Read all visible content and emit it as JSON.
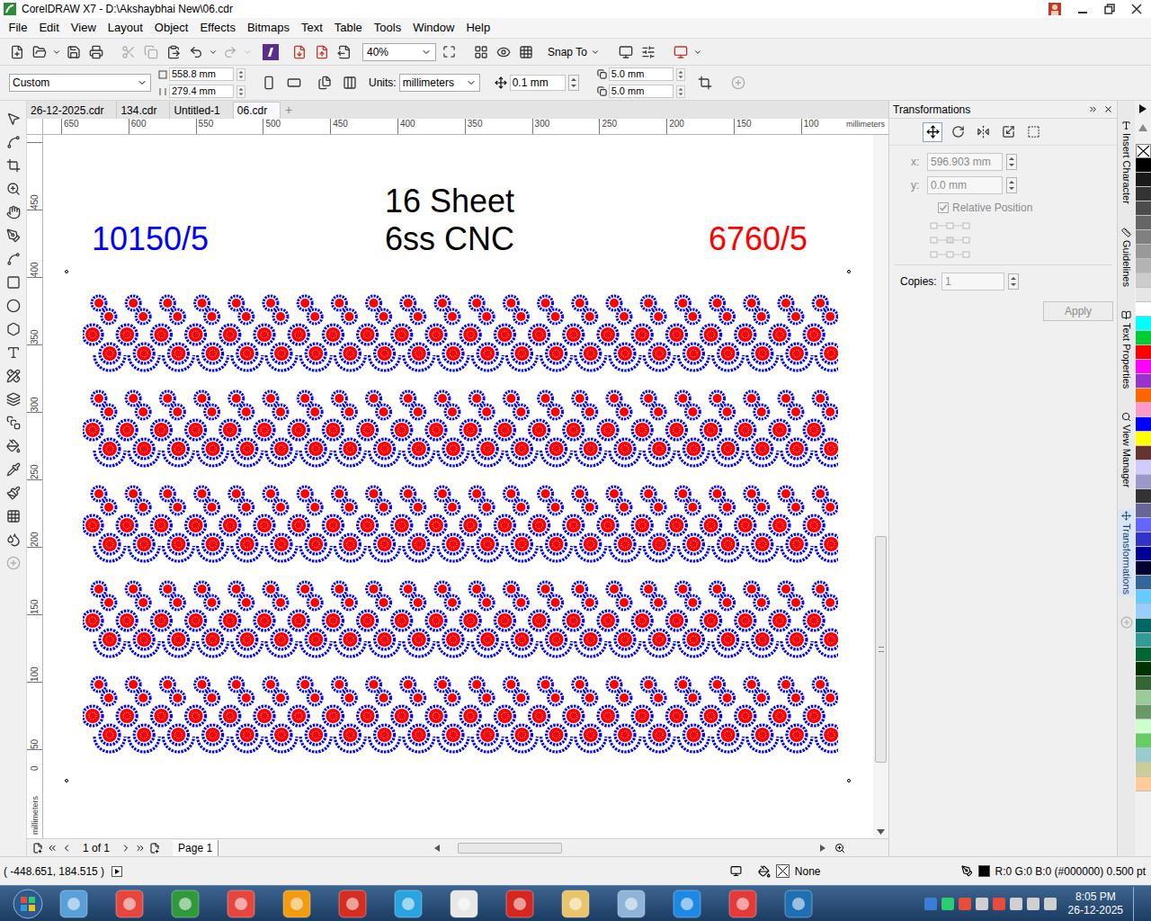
{
  "window": {
    "title": "CorelDRAW X7 - D:\\Akshaybhai New\\06.cdr"
  },
  "menu": [
    "File",
    "Edit",
    "View",
    "Layout",
    "Object",
    "Effects",
    "Bitmaps",
    "Text",
    "Table",
    "Tools",
    "Window",
    "Help"
  ],
  "toolbar": {
    "zoom": "40%",
    "snap": "Snap To"
  },
  "property_bar": {
    "preset": "Custom",
    "width": "558.8 mm",
    "height": "279.4 mm",
    "units_label": "Units:",
    "units": "millimeters",
    "nudge": "0.1 mm",
    "dup_x": "5.0 mm",
    "dup_y": "5.0 mm"
  },
  "doc_tabs": [
    {
      "label": "26-12-2025.cdr",
      "selected": false
    },
    {
      "label": "134.cdr",
      "selected": false
    },
    {
      "label": "Untitled-1",
      "selected": false
    },
    {
      "label": "06.cdr",
      "selected": true
    }
  ],
  "new_tab": "+",
  "rulers": {
    "horizontal": [
      "650",
      "600",
      "550",
      "500",
      "450",
      "400",
      "350",
      "300",
      "250",
      "200",
      "150",
      "100"
    ],
    "vertical": [
      "450",
      "400",
      "350",
      "300",
      "250",
      "200",
      "150",
      "100",
      "50",
      "0"
    ],
    "unit": "millimeters"
  },
  "document": {
    "title_lines": [
      "16 Sheet",
      "6ss CNC"
    ],
    "left_label": {
      "text": "10150/5",
      "color": "#0000ff"
    },
    "right_label": {
      "text": "6760/5",
      "color": "#ff0000"
    },
    "pattern": {
      "rows": 5,
      "columns": 22,
      "ring_color": "#0000ff",
      "center_color": "#ff0000"
    }
  },
  "page_nav": {
    "counter": "1 of 1",
    "pages": [
      {
        "label": "Page 1",
        "selected": true
      }
    ]
  },
  "docker": {
    "title": "Transformations",
    "x_label": "x:",
    "x": "596.903 mm",
    "y_label": "y:",
    "y": "0.0 mm",
    "relative": {
      "label": "Relative Position",
      "checked": true,
      "disabled": true
    },
    "copies_label": "Copies:",
    "copies": "1",
    "apply": "Apply",
    "fields_disabled": true
  },
  "side_tabs": [
    {
      "label": "Insert Character",
      "selected": false
    },
    {
      "label": "Guidelines",
      "selected": false
    },
    {
      "label": "Text Properties",
      "selected": false
    },
    {
      "label": "View Manager",
      "selected": false
    },
    {
      "label": "Transformations",
      "selected": true
    }
  ],
  "palette": [
    {
      "kind": "none"
    },
    {
      "kind": "swatch",
      "color": "#000000"
    },
    {
      "kind": "swatch",
      "color": "#1a1a1a"
    },
    {
      "kind": "swatch",
      "color": "#333333"
    },
    {
      "kind": "swatch",
      "color": "#4d4d4d"
    },
    {
      "kind": "swatch",
      "color": "#666666"
    },
    {
      "kind": "swatch",
      "color": "#808080"
    },
    {
      "kind": "swatch",
      "color": "#999999"
    },
    {
      "kind": "swatch",
      "color": "#b3b3b3"
    },
    {
      "kind": "swatch",
      "color": "#cccccc"
    },
    {
      "kind": "swatch",
      "color": "#e6e6e6"
    },
    {
      "kind": "swatch",
      "color": "#ffffff"
    },
    {
      "kind": "swatch",
      "color": "#00ffff"
    },
    {
      "kind": "swatch",
      "color": "#00cc33"
    },
    {
      "kind": "swatch",
      "color": "#ff0000"
    },
    {
      "kind": "swatch",
      "color": "#ff00ff"
    },
    {
      "kind": "swatch",
      "color": "#9933cc"
    },
    {
      "kind": "swatch",
      "color": "#ff6600"
    },
    {
      "kind": "swatch",
      "color": "#ff99cc"
    },
    {
      "kind": "swatch",
      "color": "#0000ff"
    },
    {
      "kind": "swatch",
      "color": "#ffff00"
    },
    {
      "kind": "swatch",
      "color": "#663333"
    },
    {
      "kind": "swatch",
      "color": "#ccccff"
    },
    {
      "kind": "swatch",
      "color": "#9999cc"
    },
    {
      "kind": "swatch",
      "color": "#333333"
    },
    {
      "kind": "swatch",
      "color": "#666699"
    },
    {
      "kind": "swatch",
      "color": "#6666ff"
    },
    {
      "kind": "swatch",
      "color": "#3333cc"
    },
    {
      "kind": "swatch",
      "color": "#000099"
    },
    {
      "kind": "swatch",
      "color": "#000033"
    },
    {
      "kind": "swatch",
      "color": "#336699"
    },
    {
      "kind": "swatch",
      "color": "#66ccff"
    },
    {
      "kind": "swatch",
      "color": "#99ccff"
    },
    {
      "kind": "swatch",
      "color": "#006666"
    },
    {
      "kind": "swatch",
      "color": "#339999"
    },
    {
      "kind": "swatch",
      "color": "#006633"
    },
    {
      "kind": "swatch",
      "color": "#003300"
    },
    {
      "kind": "swatch",
      "color": "#336633"
    },
    {
      "kind": "swatch",
      "color": "#99cc99"
    },
    {
      "kind": "swatch",
      "color": "#669966"
    },
    {
      "kind": "swatch",
      "color": "#ccffcc"
    },
    {
      "kind": "swatch",
      "color": "#66cc66"
    },
    {
      "kind": "swatch",
      "color": "#99cccc"
    },
    {
      "kind": "swatch",
      "color": "#cccc99"
    },
    {
      "kind": "swatch",
      "color": "#ffcc99"
    }
  ],
  "status": {
    "coords": "( -448.651, 184.515 )",
    "fill": "None",
    "outline": "R:0 G:0 B:0 (#000000) 0.500 pt",
    "outline_color": "#000000"
  },
  "taskbar": {
    "time": "8:05 PM",
    "date": "26-12-2025"
  }
}
